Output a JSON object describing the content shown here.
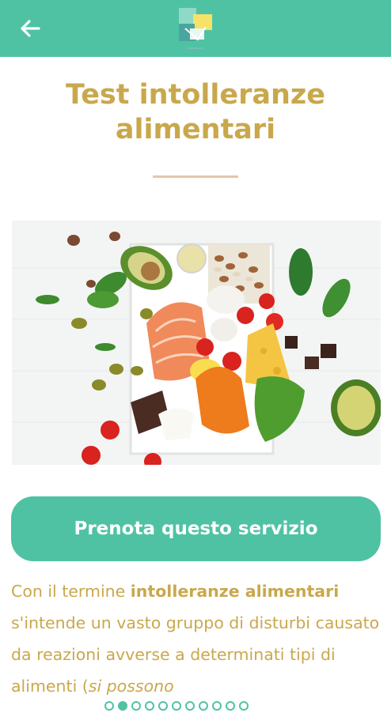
{
  "header": {
    "back_icon": "arrow-left-icon",
    "logo": "clinic-logo",
    "background": "#4fc2a4"
  },
  "page": {
    "title": "Test intolleranze alimentari"
  },
  "hero_image": {
    "subject": "healthy-food-box"
  },
  "cta": {
    "label": "Prenota questo servizio"
  },
  "description": {
    "text_before": "Con il termine ",
    "highlight": "intolleranze alimentari",
    "text_after": " s'intende un vasto gruppo di disturbi causato da reazioni avverse a determinati tipi di alimenti (",
    "italic": "si possono"
  },
  "pager": {
    "count": 11,
    "active_index": 1
  },
  "colors": {
    "accent": "#4fc2a4",
    "title": "#c9a84c",
    "divider": "#e3c7a8"
  }
}
